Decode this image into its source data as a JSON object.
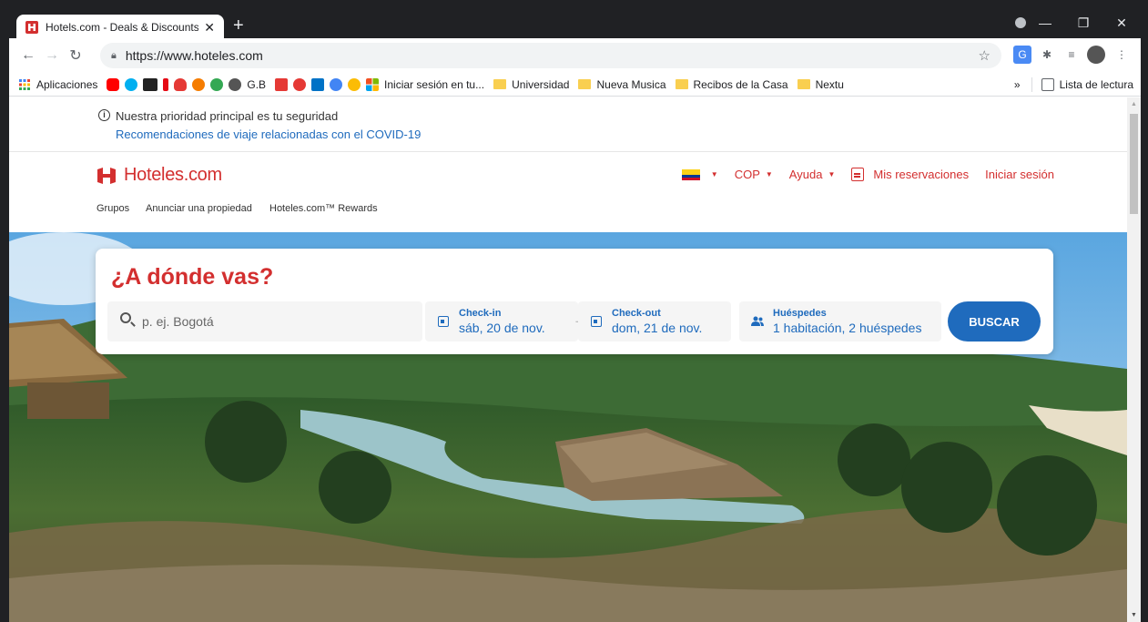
{
  "browser": {
    "tab_title": "Hotels.com - Deals & Discounts f",
    "new_tab": "+",
    "url": "https://www.hoteles.com",
    "window_controls": [
      "—",
      "❐",
      "✕"
    ]
  },
  "bookmarks": {
    "apps_label": "Aplicaciones",
    "gb_label": "G.B",
    "iniciar_label": "Iniciar sesión en tu...",
    "folders": [
      "Universidad",
      "Nueva Musica",
      "Recibos de la Casa",
      "Nextu"
    ],
    "more": "»",
    "reading_list": "Lista de lectura"
  },
  "covid": {
    "line1": "Nuestra prioridad principal es tu seguridad",
    "line2": "Recomendaciones de viaje relacionadas con el COVID-19"
  },
  "header": {
    "logo": "Hoteles.com",
    "currency": "COP",
    "help": "Ayuda",
    "reservations": "Mis reservaciones",
    "signin": "Iniciar sesión"
  },
  "subnav": {
    "groups": "Grupos",
    "advertise": "Anunciar una propiedad",
    "rewards": "Hoteles.com™ Rewards"
  },
  "search": {
    "heading": "¿A dónde vas?",
    "destination_placeholder": "p. ej. Bogotá",
    "checkin_label": "Check-in",
    "checkin_value": "sáb, 20 de nov.",
    "checkout_label": "Check-out",
    "checkout_value": "dom, 21 de nov.",
    "guests_label": "Huéspedes",
    "guests_value": "1 habitación, 2 huéspedes",
    "button": "BUSCAR"
  },
  "colors": {
    "brand_red": "#d32f2f",
    "link_blue": "#1f6bbd"
  }
}
